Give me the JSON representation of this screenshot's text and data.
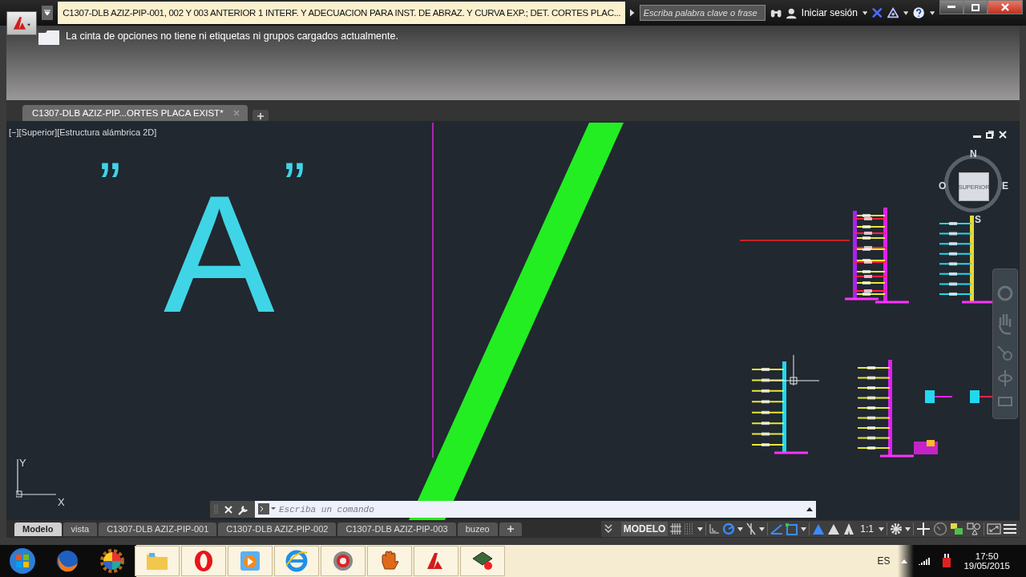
{
  "title_bar": {
    "title": "C1307-DLB AZIZ-PIP-001, 002 Y 003 ANTERIOR 1 INTERF. Y ADECUACION PARA INST. DE ABRAZ. Y CURVA EXP.; DET. CORTES PLAC...",
    "search": {
      "placeholder": "Escriba palabra clave o frase"
    },
    "sign_in": "Iniciar sesión"
  },
  "ribbon": {
    "message": "La cinta de opciones no tiene ni etiquetas ni grupos cargados actualmente."
  },
  "file_tabs": [
    {
      "label": "C1307-DLB AZIZ-PIP...ORTES PLACA EXIST*",
      "selected": true
    }
  ],
  "viewport": {
    "label": "[−][Superior][Estructura alámbrica 2D]",
    "canvas_texts": [
      "”",
      "A",
      "”"
    ],
    "viewcube": {
      "face": "SUPERIOR",
      "north": "N",
      "east": "E",
      "south": "S",
      "west": "O"
    },
    "ucs": {
      "x": "X",
      "y": "Y"
    }
  },
  "command_line": {
    "placeholder": "Escriba un comando"
  },
  "layout_tabs": [
    {
      "label": "Modelo",
      "selected": true
    },
    {
      "label": "vista",
      "selected": false
    },
    {
      "label": "C1307-DLB AZIZ-PIP-001",
      "selected": false
    },
    {
      "label": "C1307-DLB AZIZ-PIP-002",
      "selected": false
    },
    {
      "label": "C1307-DLB AZIZ-PIP-003",
      "selected": false
    },
    {
      "label": "buzeo",
      "selected": false
    }
  ],
  "status_bar": {
    "space": "MODELO",
    "scale": "1:1"
  },
  "taskbar": {
    "language": "ES",
    "time": "17:50",
    "date": "19/05/2015"
  }
}
